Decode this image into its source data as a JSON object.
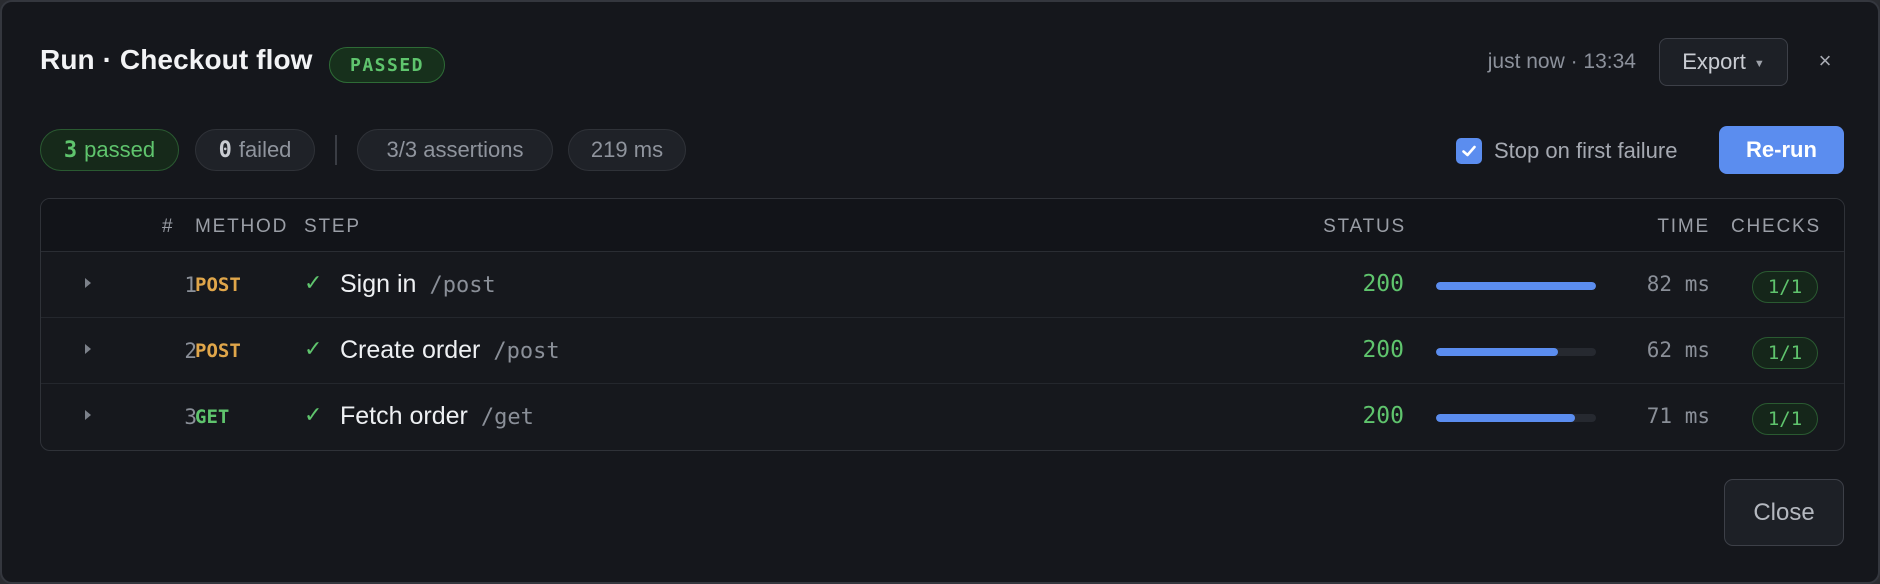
{
  "header": {
    "title": "Run · Checkout flow",
    "status_badge": "PASSED",
    "timestamp": "just now · 13:34",
    "export_label": "Export",
    "close_glyph": "×"
  },
  "summary": {
    "passed_count": "3",
    "passed_label": "passed",
    "failed_count": "0",
    "failed_label": "failed",
    "assertions": "3/3 assertions",
    "duration": "219 ms",
    "stop_on_failure_label": "Stop on first failure",
    "stop_on_failure_checked": true,
    "rerun_label": "Re-run"
  },
  "table": {
    "columns": {
      "index": "#",
      "method": "METHOD",
      "step": "STEP",
      "status": "STATUS",
      "time": "TIME",
      "checks": "CHECKS"
    },
    "rows": [
      {
        "index": "1",
        "method": "POST",
        "check": "✓",
        "name": "Sign in",
        "path": "/post",
        "status": "200",
        "time": "82 ms",
        "duration_fraction": 1.0,
        "checks": "1/1"
      },
      {
        "index": "2",
        "method": "POST",
        "check": "✓",
        "name": "Create order",
        "path": "/post",
        "status": "200",
        "time": "62 ms",
        "duration_fraction": 0.76,
        "checks": "1/1"
      },
      {
        "index": "3",
        "method": "GET",
        "check": "✓",
        "name": "Fetch order",
        "path": "/get",
        "status": "200",
        "time": "71 ms",
        "duration_fraction": 0.87,
        "checks": "1/1"
      }
    ]
  },
  "footer": {
    "close_label": "Close"
  },
  "colors": {
    "accent": "#5b8def",
    "success": "#5fc46d",
    "post_method": "#e0a64a",
    "background": "#15171c"
  }
}
